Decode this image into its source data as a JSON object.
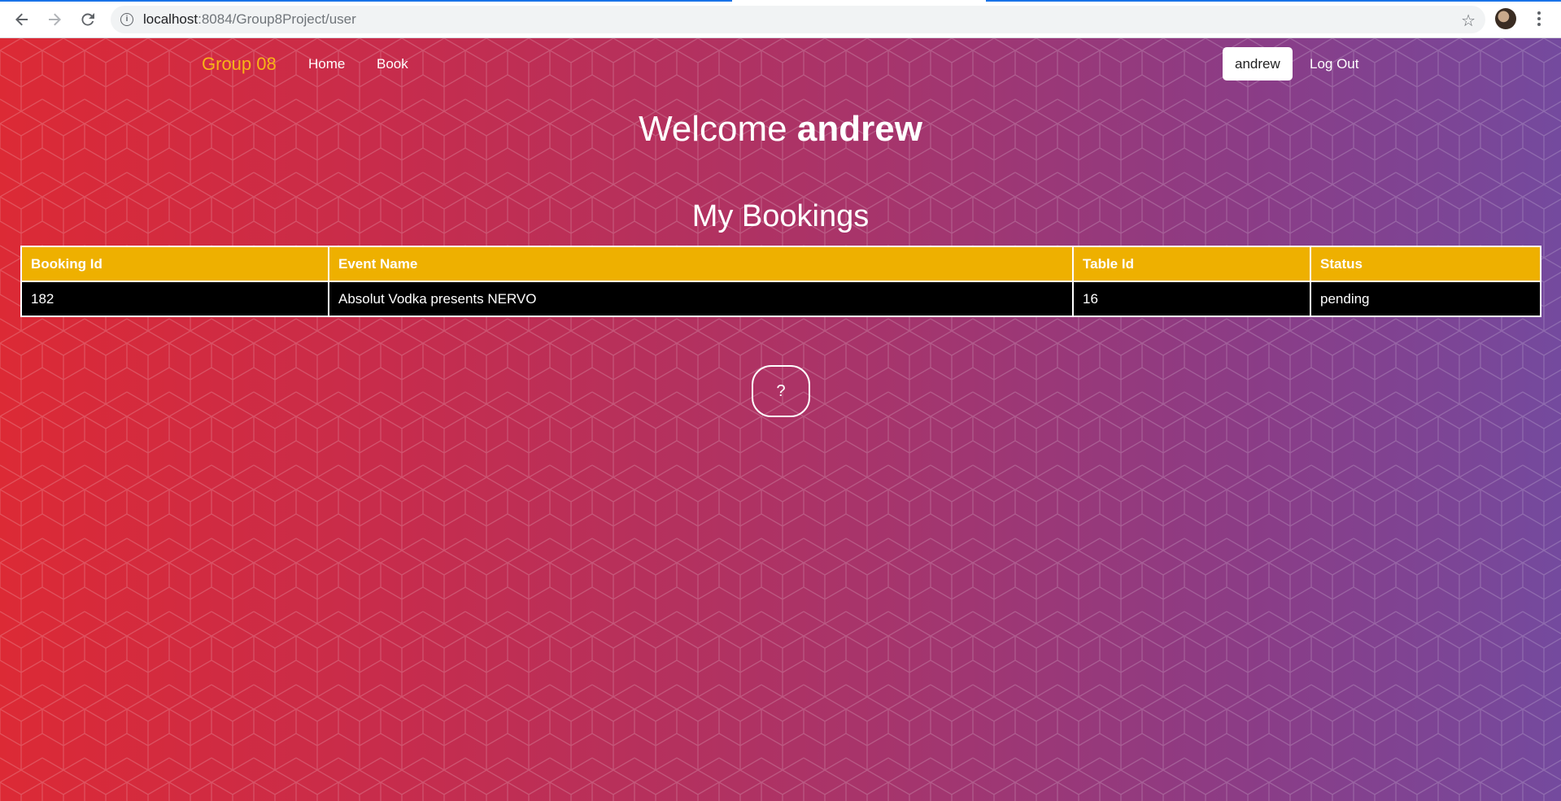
{
  "browser": {
    "url_host": "localhost",
    "url_path": ":8084/Group8Project/user",
    "icons": [
      "back-icon",
      "forward-icon",
      "reload-icon",
      "info-icon",
      "star-icon",
      "menu-icon"
    ]
  },
  "nav": {
    "brand": "Group 08",
    "links": [
      "Home",
      "Book"
    ],
    "user": "andrew",
    "logout": "Log Out"
  },
  "welcome": {
    "prefix": "Welcome ",
    "name": "andrew"
  },
  "bookings": {
    "title": "My Bookings",
    "headers": [
      "Booking Id",
      "Event Name",
      "Table Id",
      "Status"
    ],
    "rows": [
      [
        "182",
        "Absolut Vodka presents NERVO",
        "16",
        "pending"
      ]
    ]
  },
  "help": {
    "label": "?"
  },
  "colors": {
    "brand": "#f8b417",
    "table_header": "#eeb000",
    "table_row": "#000000",
    "gradient_start": "#dc2a35",
    "gradient_end": "#744a9e"
  }
}
